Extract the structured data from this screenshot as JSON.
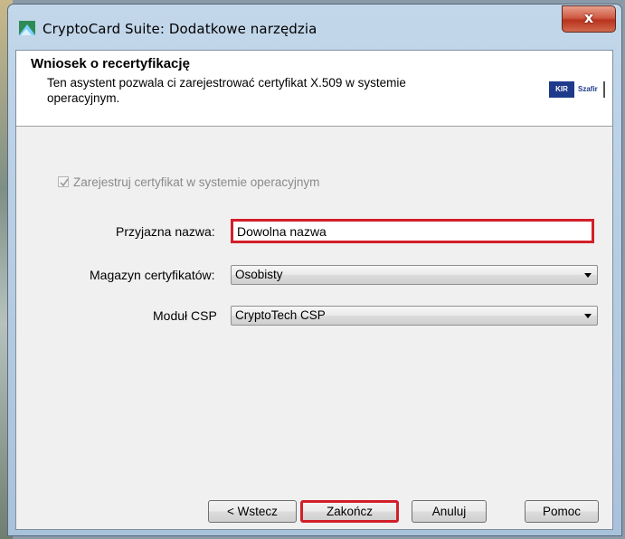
{
  "window": {
    "title": "CryptoCard Suite: Dodatkowe narzędzia",
    "close_label": "x"
  },
  "header": {
    "title": "Wniosek o recertyfikację",
    "description": "Ten asystent pozwala ci zarejestrować certyfikat X.509 w systemie operacyjnym.",
    "logo_box_text": "KIR",
    "logo_text": "Szafir"
  },
  "form": {
    "register_checkbox_label": "Zarejestruj certyfikat w systemie operacyjnym",
    "register_checked": true,
    "friendly_name_label": "Przyjazna nazwa:",
    "friendly_name_value": "Dowolna nazwa",
    "store_label": "Magazyn certyfikatów:",
    "store_value": "Osobisty",
    "csp_label": "Moduł CSP",
    "csp_value": "CryptoTech CSP"
  },
  "buttons": {
    "back": "< Wstecz",
    "finish": "Zakończ",
    "cancel": "Anuluj",
    "help": "Pomoc"
  },
  "colors": {
    "highlight": "#d21f2a",
    "titlebar": "#a9c2db"
  }
}
